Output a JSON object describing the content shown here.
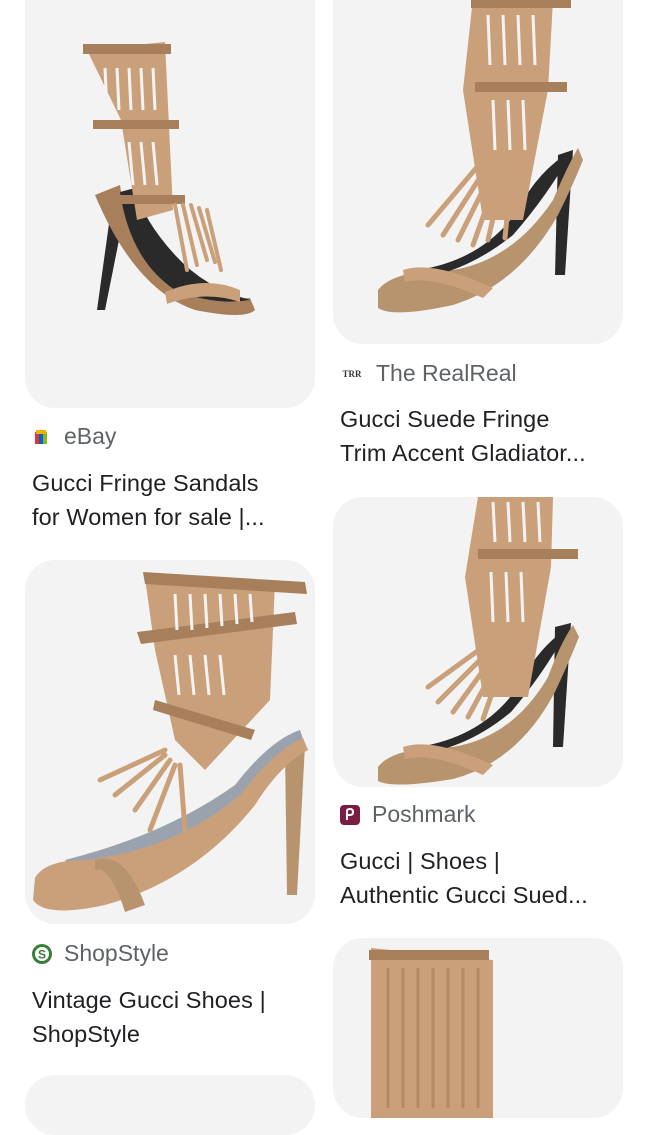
{
  "results": [
    {
      "source": "eBay",
      "favicon": "ebay-favicon",
      "title_lines": [
        "Gucci Fringe Sandals",
        "for Women for sale |..."
      ]
    },
    {
      "source": "The RealReal",
      "favicon": "therealreal-favicon",
      "favicon_text": "TRR",
      "title_lines": [
        "Gucci Suede Fringe",
        "Trim Accent Gladiator..."
      ]
    },
    {
      "source": "ShopStyle",
      "favicon": "shopstyle-favicon",
      "favicon_text": "S",
      "title_lines": [
        "Vintage Gucci Shoes |",
        "ShopStyle"
      ]
    },
    {
      "source": "Poshmark",
      "favicon": "poshmark-favicon",
      "title_lines": [
        "Gucci | Shoes |",
        "Authentic Gucci Sued..."
      ]
    }
  ],
  "colors": {
    "suede": "#c9a07a",
    "suede_dark": "#a77f5b",
    "insole": "#2a2a2a",
    "card_bg": "#f3f3f3",
    "source_text": "#5f6368",
    "title_text": "#202124",
    "shopstyle_green": "#3a7d3a",
    "poshmark_maroon": "#7b1d43"
  }
}
